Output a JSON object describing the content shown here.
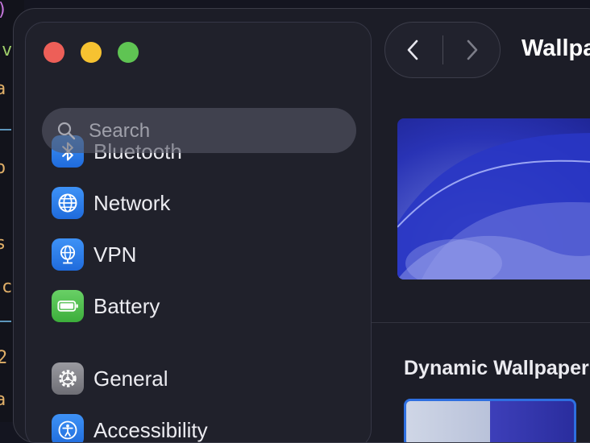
{
  "window": {
    "controls": {
      "close": "close",
      "minimize": "minimize",
      "zoom": "zoom"
    }
  },
  "sidebar": {
    "search": {
      "placeholder": "Search",
      "value": ""
    },
    "items": [
      {
        "label": "Bluetooth",
        "icon": "bluetooth-icon",
        "color": "#2f80ed"
      },
      {
        "label": "Network",
        "icon": "globe-icon",
        "color": "#2f80ed"
      },
      {
        "label": "VPN",
        "icon": "vpn-globe-icon",
        "color": "#2f80ed"
      },
      {
        "label": "Battery",
        "icon": "battery-icon",
        "color": "#4cbf4b"
      },
      {
        "label": "General",
        "icon": "gear-icon",
        "color": "#8a8a90"
      },
      {
        "label": "Accessibility",
        "icon": "accessibility-icon",
        "color": "#2f80ed"
      }
    ]
  },
  "content": {
    "title": "Wallpa",
    "section_title": "Dynamic Wallpaper",
    "nav": {
      "back_icon": "chevron-left-icon",
      "forward_icon": "chevron-right-icon"
    }
  }
}
